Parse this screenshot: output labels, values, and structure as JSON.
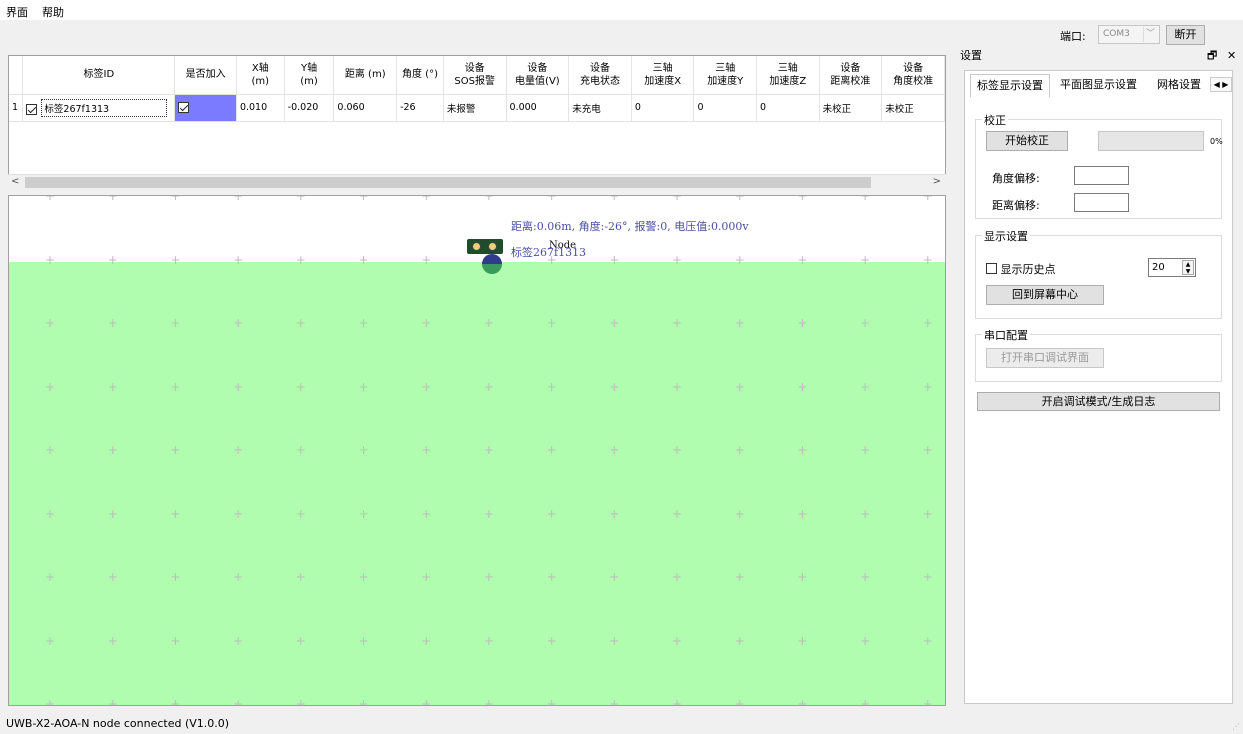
{
  "menu": {
    "items": [
      "界面",
      "帮助"
    ]
  },
  "toolbar": {
    "port_label": "端口:",
    "port_value": "COM3",
    "disconnect_label": "断开"
  },
  "table": {
    "columns": [
      {
        "key": "rownum",
        "label": ""
      },
      {
        "key": "tag_id",
        "label": "标签ID"
      },
      {
        "key": "joined",
        "label": "是否加入"
      },
      {
        "key": "x",
        "label": "X轴\n(m)"
      },
      {
        "key": "y",
        "label": "Y轴\n(m)"
      },
      {
        "key": "dist",
        "label": "距离 (m)"
      },
      {
        "key": "angle",
        "label": "角度 (°)"
      },
      {
        "key": "sos",
        "label": "设备\nSOS报警"
      },
      {
        "key": "volt",
        "label": "设备\n电量值(V)"
      },
      {
        "key": "charge",
        "label": "设备\n充电状态"
      },
      {
        "key": "ax",
        "label": "三轴\n加速度X"
      },
      {
        "key": "ay",
        "label": "三轴\n加速度Y"
      },
      {
        "key": "az",
        "label": "三轴\n加速度Z"
      },
      {
        "key": "dcal",
        "label": "设备\n距离校准"
      },
      {
        "key": "acal",
        "label": "设备\n角度校准"
      }
    ],
    "rows": [
      {
        "rownum": "1",
        "tag_id": "标签267f1313",
        "tag_checked": true,
        "joined": true,
        "x": "0.010",
        "y": "-0.020",
        "dist": "0.060",
        "angle": "-26",
        "sos": "未报警",
        "volt": "0.000",
        "charge": "未充电",
        "ax": "0",
        "ay": "0",
        "az": "0",
        "dcal": "未校正",
        "acal": "未校正"
      }
    ]
  },
  "map": {
    "info_text": "距离:0.06m, 角度:-26°, 报警:0, 电压值:0.000v",
    "tag_label": "标签267f1313",
    "node_label": "Node"
  },
  "settings": {
    "title": "设置",
    "tabs": [
      "标签显示设置",
      "平面图显示设置",
      "网格设置"
    ],
    "calibration": {
      "group_title": "校正",
      "start_button": "开始校正",
      "progress_text": "0%",
      "progress": 0,
      "angle_offset_label": "角度偏移:",
      "angle_offset_value": "",
      "dist_offset_label": "距离偏移:",
      "dist_offset_value": ""
    },
    "display": {
      "group_title": "显示设置",
      "history_label": "显示历史点",
      "history_count": "20",
      "center_button": "回到屏幕中心"
    },
    "serial": {
      "group_title": "串口配置",
      "open_button": "打开串口调试界面"
    },
    "debug_button": "开启调试模式/生成日志"
  },
  "status": {
    "text": "UWB-X2-AOA-N node connected (V1.0.0)"
  }
}
